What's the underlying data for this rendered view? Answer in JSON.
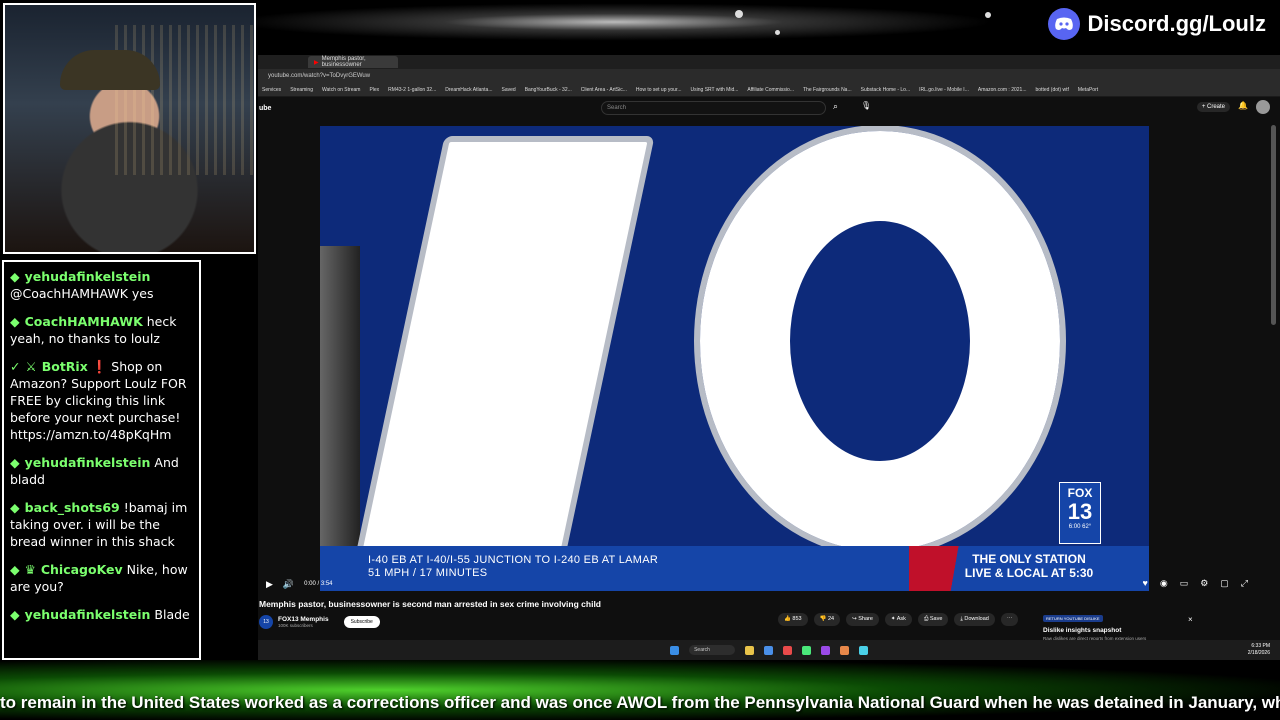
{
  "discord": {
    "label": "Discord.gg/Loulz"
  },
  "chat": {
    "messages": [
      {
        "user": "yehudafinkelstein",
        "text": "@CoachHAMHAWK yes"
      },
      {
        "user": "CoachHAMHAWK",
        "text": "heck yeah, no thanks to loulz"
      },
      {
        "user": "BotRix",
        "text": "❗ Shop on Amazon? Support Loulz FOR FREE by clicking this link before your next purchase! https://amzn.to/48pKqHm"
      },
      {
        "user": "yehudafinkelstein",
        "text": "And bladd"
      },
      {
        "user": "back_shots69",
        "text": "!bamaj im taking over. i will be the bread winner in this shack"
      },
      {
        "user": "ChicagoKev",
        "text": "Nike, how are you?"
      },
      {
        "user": "yehudafinkelstein",
        "text": "Blade"
      }
    ]
  },
  "browser": {
    "tab_title": "Memphis pastor, businessowner",
    "url": "youtube.com/watch?v=ToDvyrGEWuw",
    "bookmarks": [
      "Services",
      "Streaming",
      "Watch on Stream",
      "Plex",
      "RM43-2 1-gallon 32...",
      "DreamHack Atlanta...",
      "Saved",
      "BangYourBuck - 32...",
      "Client Area - ArtSic...",
      "How to set up your...",
      "Using SRT with Mid...",
      "Affiliate Commissio...",
      "The Fairgrounds Na...",
      "Substack Home - Lo...",
      "IRL.go.live - Mobile I...",
      "Amazon.com : 2021...",
      "botted (dot) wtf",
      "MetaPort"
    ]
  },
  "youtube": {
    "logo": "ube",
    "search_placeholder": "Search",
    "create_label": "+ Create",
    "video_title": "Memphis pastor, businessowner is second man arrested in sex crime involving child",
    "channel_name": "FOX13 Memphis",
    "channel_subs": "100K subscribers",
    "subscribe_label": "Subscribe",
    "time": "0:00 / 3:54",
    "likes": "853",
    "dislikes": "24",
    "share_label": "Share",
    "ask_label": "Ask",
    "save_label": "Save",
    "download_label": "Download",
    "dislike_badge": "RETURN YOUTUBE DISLIKE",
    "dislike_title": "Dislike insights snapshot",
    "dislike_sub": "Raw dislikes are direct reports from extension users"
  },
  "video": {
    "chyron_line1": "I-40 EB AT I-40/I-55 JUNCTION TO I-240 EB AT LAMAR",
    "chyron_line2": "51 MPH / 17 MINUTES",
    "promo_line1": "THE ONLY STATION",
    "promo_line2": "LIVE & LOCAL AT 5:30",
    "bug_top": "FOX",
    "bug_num": "13",
    "bug_time": "6:00  62°"
  },
  "taskbar": {
    "search": "Search",
    "clock_time": "6:33 PM",
    "clock_date": "2/18/2026"
  },
  "ticker": {
    "text": "to remain in the United States worked as a corrections officer and was once AWOL from the Pennsylvania National Guard when he was detained in January, wh"
  },
  "colors": {
    "accent": "#7bff6e",
    "fox_blue": "#1545a8",
    "fox_red": "#c0102a",
    "discord": "#5865f2"
  }
}
